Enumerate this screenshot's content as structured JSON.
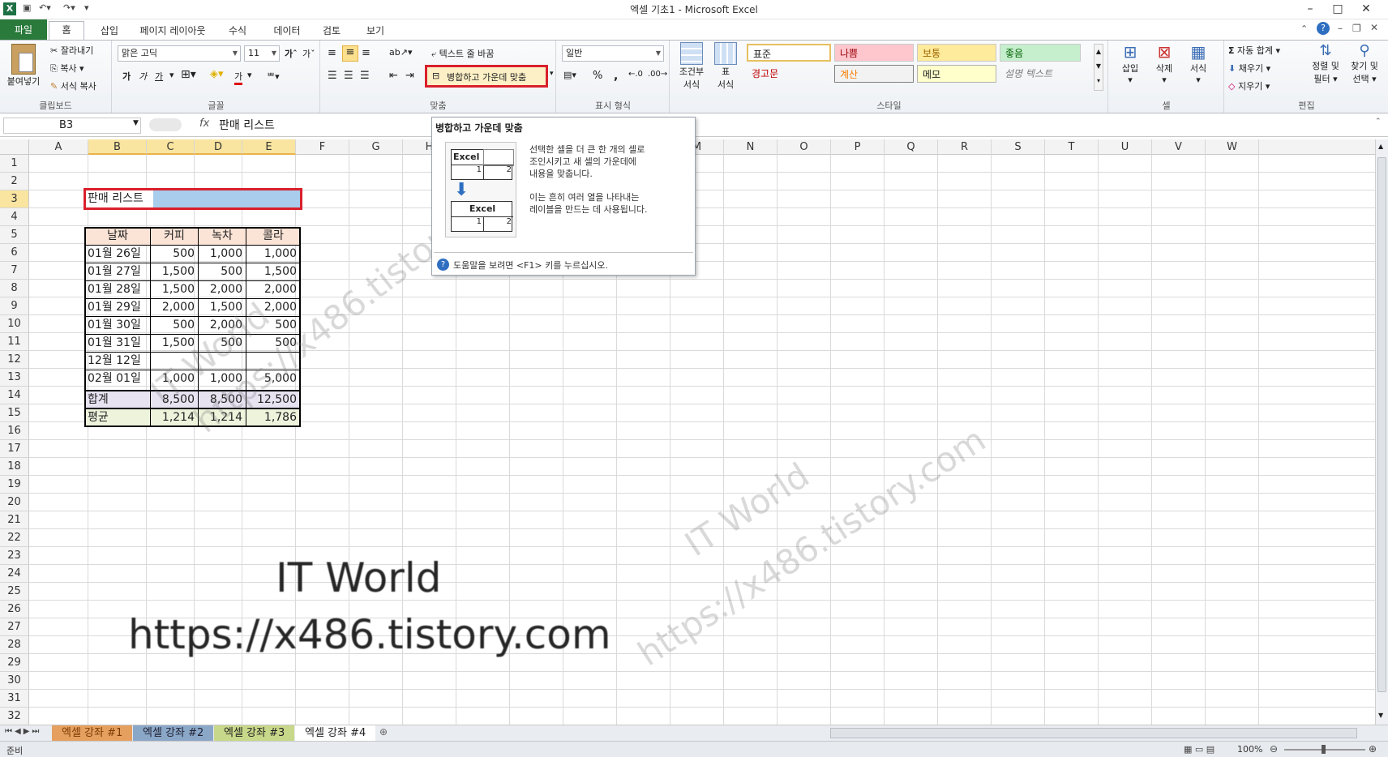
{
  "window": {
    "title": "엑셀 기초1  -  Microsoft Excel"
  },
  "tabs": {
    "file": "파일",
    "home": "홈",
    "insert": "삽입",
    "layout": "페이지 레이아웃",
    "formulas": "수식",
    "data": "데이터",
    "review": "검토",
    "view": "보기"
  },
  "clipboard": {
    "paste": "붙여넣기",
    "cut": "잘라내기",
    "copy": "복사",
    "format_painter": "서식 복사",
    "label": "클립보드"
  },
  "font": {
    "name": "맑은 고딕",
    "size": "11",
    "label": "글꼴",
    "bold": "가",
    "italic": "가",
    "underline": "가"
  },
  "alignment": {
    "wrap": "텍스트 줄 바꿈",
    "merge": "병합하고 가운데 맞춤",
    "label": "맞춤"
  },
  "number": {
    "format": "일반",
    "percent": "%",
    "comma": ",",
    "label": "표시 형식"
  },
  "styles": {
    "cond_format": "조건부",
    "cond_format2": "서식",
    "table_format": "표",
    "table_format2": "서식",
    "normal": "표준",
    "bad": "나쁨",
    "neutral": "보통",
    "good": "좋음",
    "warning": "경고문",
    "calc": "계산",
    "memo": "메모",
    "explain": "설명 텍스트",
    "label": "스타일"
  },
  "cells_grp": {
    "insert": "삽입",
    "delete": "삭제",
    "format": "서식",
    "label": "셀"
  },
  "editing": {
    "autosum": "자동 합계",
    "fill": "채우기",
    "clear": "지우기",
    "sort": "정렬 및",
    "sort2": "필터",
    "find": "찾기 및",
    "find2": "선택",
    "label": "편집"
  },
  "formula_bar": {
    "name_box": "B3",
    "fx": "fx",
    "content": "판매 리스트"
  },
  "columns": [
    "A",
    "B",
    "C",
    "D",
    "E",
    "F",
    "G",
    "H",
    "I",
    "J",
    "K",
    "L",
    "M",
    "N",
    "O",
    "P",
    "Q",
    "R",
    "S",
    "T",
    "U",
    "V",
    "W"
  ],
  "rows": [
    "1",
    "2",
    "3",
    "4",
    "5",
    "6",
    "7",
    "8",
    "9",
    "10",
    "11",
    "12",
    "13",
    "14",
    "15",
    "16",
    "17",
    "18",
    "19",
    "20",
    "21",
    "22",
    "23",
    "24",
    "25",
    "26",
    "27",
    "28",
    "29",
    "30",
    "31",
    "32"
  ],
  "sheet": {
    "title_cell": "판매 리스트",
    "headers": [
      "날짜",
      "커피",
      "녹차",
      "콜라"
    ],
    "data": [
      [
        "01월 26일",
        "500",
        "1,000",
        "1,000"
      ],
      [
        "01월 27일",
        "1,500",
        "500",
        "1,500"
      ],
      [
        "01월 28일",
        "1,500",
        "2,000",
        "2,000"
      ],
      [
        "01월 29일",
        "2,000",
        "1,500",
        "2,000"
      ],
      [
        "01월 30일",
        "500",
        "2,000",
        "500"
      ],
      [
        "01월 31일",
        "1,500",
        "500",
        "500"
      ],
      [
        "12월 12일",
        "",
        "",
        ""
      ],
      [
        "02월 01일",
        "1,000",
        "1,000",
        "5,000"
      ]
    ],
    "total": [
      "합계",
      "8,500",
      "8,500",
      "12,500"
    ],
    "average": [
      "평균",
      "1,214",
      "1,214",
      "1,786"
    ]
  },
  "tooltip": {
    "title": "병합하고 가운데 맞춤",
    "line1": "선택한 셀을 더 큰 한 개의 셀로",
    "line2": "조인시키고 새 셀의 가운데에",
    "line3": "내용을 맞춥니다.",
    "line4": "이는 흔히 여러 열을 나타내는",
    "line5": "레이블을 만드는 데 사용됩니다.",
    "help": "도움말을 보려면 <F1> 키를 누르십시오.",
    "demo_label": "Excel",
    "demo_one": "1",
    "demo_two": "2"
  },
  "watermark": {
    "line1": "IT World",
    "line2": "https://x486.tistory.com"
  },
  "sheet_tabs": [
    "엑셀 강좌 #1",
    "엑셀 강좌 #2",
    "엑셀 강좌 #3",
    "엑셀 강좌 #4"
  ],
  "status": {
    "ready": "준비",
    "zoom": "100%"
  },
  "colors": {
    "file_tab": "#2a7a3b",
    "highlight_red": "#d9202c",
    "header_fill": "#fbe3d6",
    "total_fill": "#e7e3f1",
    "avg_fill": "#eef3dc",
    "selection_fill": "#a9cdec"
  }
}
